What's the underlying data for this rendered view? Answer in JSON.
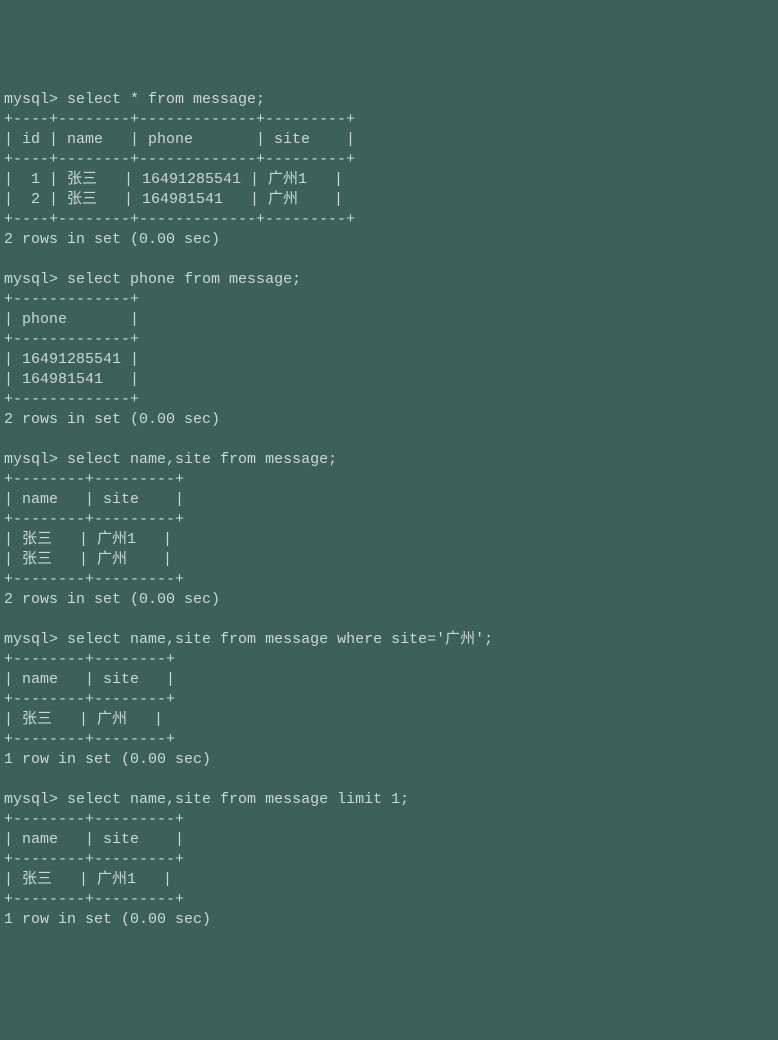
{
  "prompt": "mysql>",
  "queries": {
    "q1": {
      "command": "select * from message;",
      "border_top": "+----+--------+-------------+---------+",
      "header": "| id | name   | phone       | site    |",
      "border_mid": "+----+--------+-------------+---------+",
      "rows": [
        "|  1 | 张三   | 16491285541 | 广州1   |",
        "|  2 | 张三   | 164981541   | 广州    |"
      ],
      "border_bot": "+----+--------+-------------+---------+",
      "result": "2 rows in set (0.00 sec)"
    },
    "q2": {
      "command": "select phone from message;",
      "border_top": "+-------------+",
      "header": "| phone       |",
      "border_mid": "+-------------+",
      "rows": [
        "| 16491285541 |",
        "| 164981541   |"
      ],
      "border_bot": "+-------------+",
      "result": "2 rows in set (0.00 sec)"
    },
    "q3": {
      "command": "select name,site from message;",
      "border_top": "+--------+---------+",
      "header": "| name   | site    |",
      "border_mid": "+--------+---------+",
      "rows": [
        "| 张三   | 广州1   |",
        "| 张三   | 广州    |"
      ],
      "border_bot": "+--------+---------+",
      "result": "2 rows in set (0.00 sec)"
    },
    "q4": {
      "command": "select name,site from message where site='广州';",
      "border_top": "+--------+--------+",
      "header": "| name   | site   |",
      "border_mid": "+--------+--------+",
      "rows": [
        "| 张三   | 广州   |"
      ],
      "border_bot": "+--------+--------+",
      "result": "1 row in set (0.00 sec)"
    },
    "q5": {
      "command": "select name,site from message limit 1;",
      "border_top": "+--------+---------+",
      "header": "| name   | site    |",
      "border_mid": "+--------+---------+",
      "rows": [
        "| 张三   | 广州1   |"
      ],
      "border_bot": "+--------+---------+",
      "result": "1 row in set (0.00 sec)"
    }
  }
}
